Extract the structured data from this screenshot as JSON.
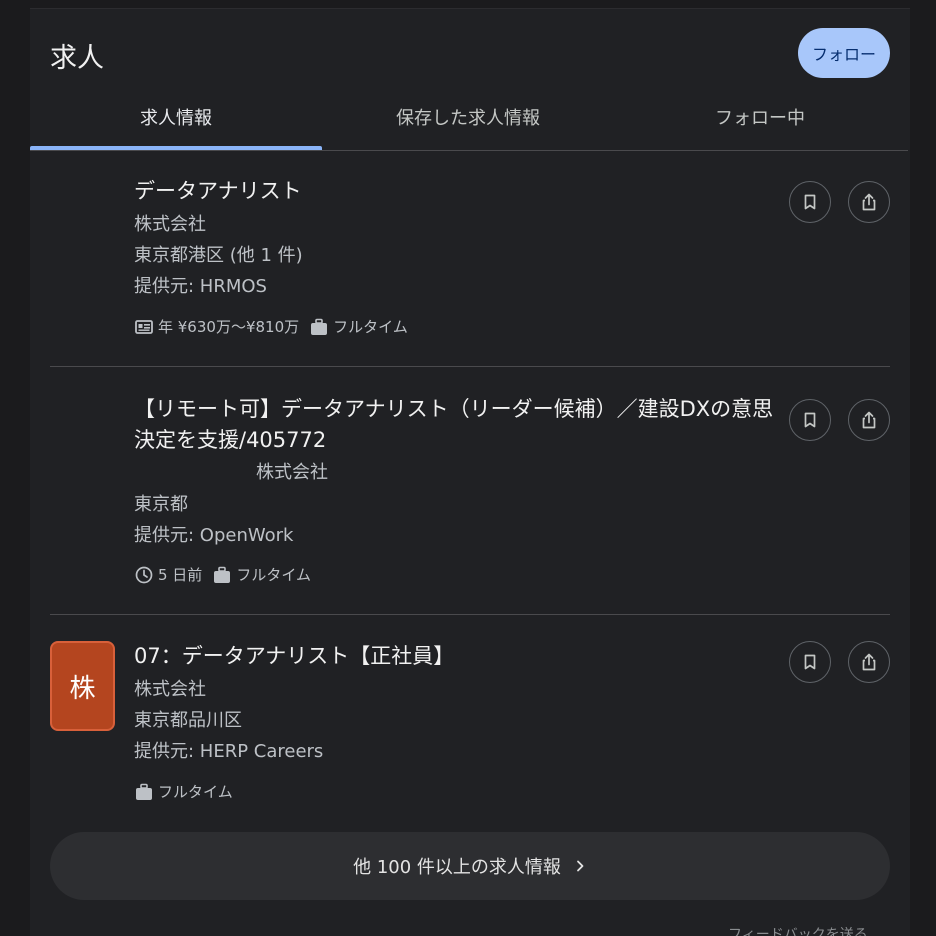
{
  "header": {
    "title": "求人",
    "follow_label": "フォロー"
  },
  "tabs": [
    {
      "label": "求人情報",
      "active": true
    },
    {
      "label": "保存した求人情報",
      "active": false
    },
    {
      "label": "フォロー中",
      "active": false
    }
  ],
  "jobs": [
    {
      "title": "データアナリスト",
      "company": "株式会社",
      "location": "東京都港区 (他 1 件)",
      "source": "提供元: HRMOS",
      "salary": "年 ¥630万〜¥810万",
      "employment": "フルタイム"
    },
    {
      "title": "【リモート可】データアナリスト（リーダー候補）／建設DXの意思決定を支援/405772",
      "company": "株式会社",
      "location": "東京都",
      "source": "提供元: OpenWork",
      "posted": "5 日前",
      "employment": "フルタイム"
    },
    {
      "logo_text": "株",
      "title": "07：データアナリスト【正社員】",
      "company": "株式会社",
      "location": "東京都品川区",
      "source": "提供元: HERP Careers",
      "employment": "フルタイム"
    }
  ],
  "more_label": "他 100 件以上の求人情報",
  "footer_text": "フィードバックを送る",
  "colors": {
    "accent": "#8ab4f8",
    "follow_bg": "#a8c7fa",
    "logo_bg": "#b4451f"
  },
  "icons": [
    "bookmark-icon",
    "share-icon",
    "salary-icon",
    "briefcase-icon",
    "clock-icon",
    "chevron-right-icon"
  ]
}
